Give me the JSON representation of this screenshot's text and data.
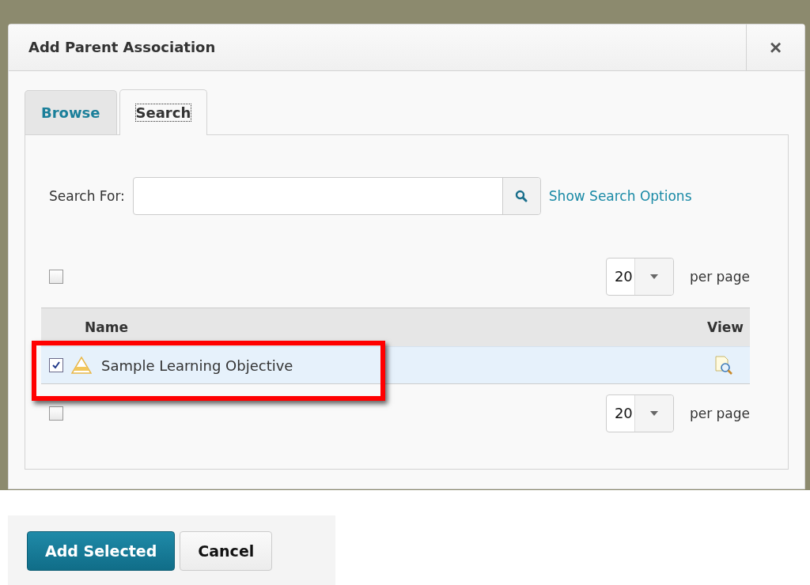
{
  "dialog": {
    "title": "Add Parent Association",
    "close": "×"
  },
  "tabs": [
    {
      "label": "Browse",
      "selected": false
    },
    {
      "label": "Search",
      "selected": true
    }
  ],
  "search": {
    "label": "Search For:",
    "link": "Show Search Options"
  },
  "top_pager": {
    "checked": false,
    "per_page": "20",
    "label": "per page"
  },
  "table": {
    "columns": [
      "Name",
      "View"
    ],
    "rows": [
      {
        "checked": true,
        "name": "Sample Learning Objective",
        "highlighted": true
      }
    ]
  },
  "bottom_pager": {
    "checked": false,
    "per_page": "20",
    "label": "per page"
  },
  "buttons": [
    {
      "label": "Add Selected",
      "kind": "primary"
    },
    {
      "label": "Cancel",
      "kind": "secondary"
    }
  ]
}
